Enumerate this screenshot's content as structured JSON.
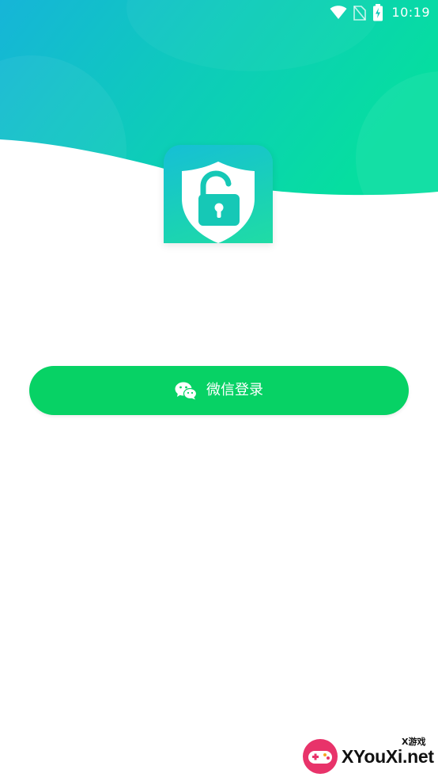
{
  "status_bar": {
    "time": "10:19",
    "icons": [
      "wifi-icon",
      "no-sim-icon",
      "battery-charging-icon"
    ]
  },
  "theme": {
    "gradient_start": "#16b5d8",
    "gradient_end": "#06dea0",
    "button_color": "#07d265"
  },
  "app_icon": {
    "icon": "shield-unlock-icon"
  },
  "login": {
    "button_label": "微信登录",
    "icon": "wechat-icon"
  },
  "watermark": {
    "brand": "XYouXi.net",
    "tag": "X游戏",
    "icon": "gamepad-icon"
  }
}
